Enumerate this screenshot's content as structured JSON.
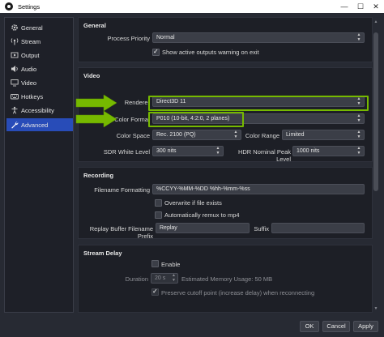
{
  "window": {
    "title": "Settings",
    "minimize": "—",
    "maximize": "☐",
    "close": "✕"
  },
  "sidebar": {
    "items": [
      {
        "label": "General",
        "icon": "gear-icon"
      },
      {
        "label": "Stream",
        "icon": "stream-icon"
      },
      {
        "label": "Output",
        "icon": "output-icon"
      },
      {
        "label": "Audio",
        "icon": "speaker-icon"
      },
      {
        "label": "Video",
        "icon": "monitor-icon"
      },
      {
        "label": "Hotkeys",
        "icon": "keyboard-icon"
      },
      {
        "label": "Accessibility",
        "icon": "accessibility-icon"
      },
      {
        "label": "Advanced",
        "icon": "wrench-icon",
        "active": true
      }
    ]
  },
  "general": {
    "title": "General",
    "process_priority_label": "Process Priority",
    "process_priority_value": "Normal",
    "show_active_outputs_label": "Show active outputs warning on exit",
    "show_active_outputs_checked": true
  },
  "video": {
    "title": "Video",
    "renderer_label": "Renderer",
    "renderer_value": "Direct3D 11",
    "color_format_label": "Color Format",
    "color_format_value": "P010 (10-bit, 4:2:0, 2 planes)",
    "color_space_label": "Color Space",
    "color_space_value": "Rec. 2100 (PQ)",
    "color_range_label": "Color Range",
    "color_range_value": "Limited",
    "sdr_white_label": "SDR White Level",
    "sdr_white_value": "300 nits",
    "hdr_nominal_label": "HDR Nominal Peak Level",
    "hdr_nominal_value": "1000 nits"
  },
  "recording": {
    "title": "Recording",
    "filename_formatting_label": "Filename Formatting",
    "filename_formatting_value": "%CCYY-%MM-%DD %hh-%mm-%ss",
    "overwrite_label": "Overwrite if file exists",
    "overwrite_checked": false,
    "remux_label": "Automatically remux to mp4",
    "remux_checked": false,
    "replay_prefix_label": "Replay Buffer Filename Prefix",
    "replay_prefix_value": "Replay",
    "suffix_label": "Suffix",
    "suffix_value": ""
  },
  "stream_delay": {
    "title": "Stream Delay",
    "enable_label": "Enable",
    "enable_checked": false,
    "duration_label": "Duration",
    "duration_value": "20 s",
    "estimated_memory": "Estimated Memory Usage: 50 MB",
    "preserve_label": "Preserve cutoff point (increase delay) when reconnecting",
    "preserve_checked": true
  },
  "footer": {
    "ok": "OK",
    "cancel": "Cancel",
    "apply": "Apply"
  },
  "colors": {
    "highlight": "#76b900",
    "accent": "#284cb8",
    "panel": "#1d1f26",
    "background": "#272a33"
  }
}
